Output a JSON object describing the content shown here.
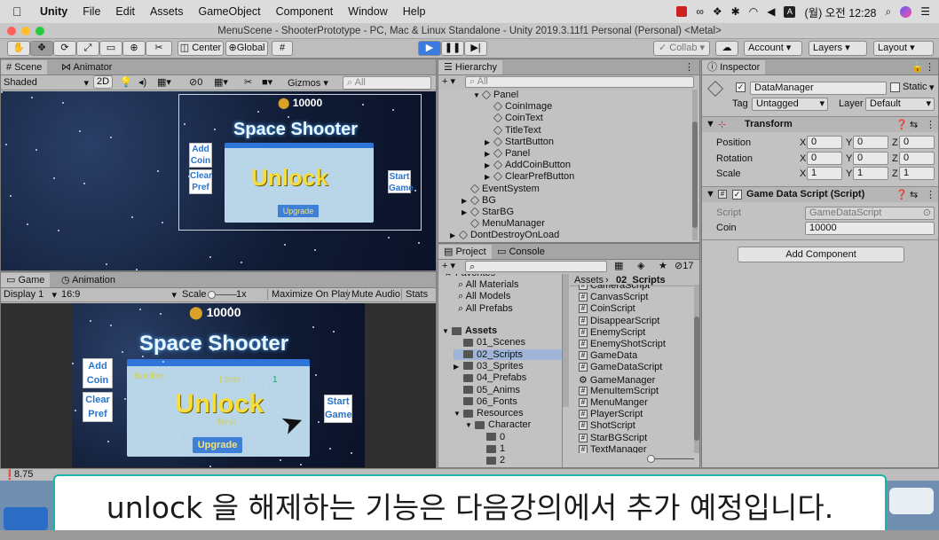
{
  "menubar": {
    "app": "Unity",
    "items": [
      "File",
      "Edit",
      "Assets",
      "GameObject",
      "Component",
      "Window",
      "Help"
    ],
    "clock": "(월) 오전 12:28"
  },
  "window_title": "MenuScene - ShooterPrototype - PC, Mac & Linux Standalone - Unity 2019.3.11f1 Personal (Personal) <Metal>",
  "toolbar": {
    "center": "Center",
    "global": "Global",
    "collab": "Collab",
    "account": "Account",
    "layers": "Layers",
    "layout": "Layout"
  },
  "scene": {
    "tab_scene": "Scene",
    "tab_animator": "Animator",
    "shading": "Shaded",
    "mode2d": "2D",
    "gizmos": "Gizmos",
    "search": "All",
    "hidden_count": "0"
  },
  "game": {
    "tab_game": "Game",
    "tab_animation": "Animation",
    "display": "Display 1",
    "aspect": "16:9",
    "scale_label": "Scale",
    "scale_value": "1x",
    "maximize": "Maximize On Play",
    "mute": "Mute Audio",
    "stats": "Stats",
    "coin": "10000",
    "title": "Space Shooter",
    "add_coin": "Add\nCoin",
    "clear_pref": "Clear\nPref",
    "start_game": "Start\nGame",
    "unlock": "Unlock",
    "bomber": "Bomber",
    "level": "Level :",
    "next": "Next",
    "upgrade": "Upgrade",
    "level_value": "1"
  },
  "hierarchy": {
    "tab": "Hierarchy",
    "search": "All",
    "items": [
      {
        "label": "Panel",
        "indent": 3,
        "arrow": "▼"
      },
      {
        "label": "CoinImage",
        "indent": 4,
        "arrow": ""
      },
      {
        "label": "CoinText",
        "indent": 4,
        "arrow": ""
      },
      {
        "label": "TitleText",
        "indent": 4,
        "arrow": ""
      },
      {
        "label": "StartButton",
        "indent": 4,
        "arrow": "▶"
      },
      {
        "label": "Panel",
        "indent": 4,
        "arrow": "▶"
      },
      {
        "label": "AddCoinButton",
        "indent": 4,
        "arrow": "▶"
      },
      {
        "label": "ClearPrefButton",
        "indent": 4,
        "arrow": "▶"
      },
      {
        "label": "EventSystem",
        "indent": 2,
        "arrow": ""
      },
      {
        "label": "BG",
        "indent": 2,
        "arrow": "▶"
      },
      {
        "label": "StarBG",
        "indent": 2,
        "arrow": "▶"
      },
      {
        "label": "MenuManager",
        "indent": 2,
        "arrow": ""
      },
      {
        "label": "DontDestroyOnLoad",
        "indent": 1,
        "arrow": "▶"
      }
    ]
  },
  "project": {
    "tab_project": "Project",
    "tab_console": "Console",
    "count": "17",
    "breadcrumb_root": "Assets",
    "breadcrumb_leaf": "02_Scripts",
    "favorites": [
      "Favorites",
      "All Materials",
      "All Models",
      "All Prefabs"
    ],
    "tree": [
      {
        "label": "Assets",
        "indent": 0,
        "arrow": "▼",
        "bold": true
      },
      {
        "label": "01_Scenes",
        "indent": 1,
        "arrow": ""
      },
      {
        "label": "02_Scripts",
        "indent": 1,
        "arrow": "",
        "selected": true
      },
      {
        "label": "03_Sprites",
        "indent": 1,
        "arrow": "▶"
      },
      {
        "label": "04_Prefabs",
        "indent": 1,
        "arrow": ""
      },
      {
        "label": "05_Anims",
        "indent": 1,
        "arrow": ""
      },
      {
        "label": "06_Fonts",
        "indent": 1,
        "arrow": ""
      },
      {
        "label": "Resources",
        "indent": 1,
        "arrow": "▼"
      },
      {
        "label": "Character",
        "indent": 2,
        "arrow": "▼"
      },
      {
        "label": "0",
        "indent": 3,
        "arrow": ""
      },
      {
        "label": "1",
        "indent": 3,
        "arrow": ""
      },
      {
        "label": "2",
        "indent": 3,
        "arrow": ""
      }
    ],
    "files": [
      "CameraScript",
      "CanvasScript",
      "CoinScript",
      "DisappearScript",
      "EnemyScript",
      "EnemyShotScript",
      "GameData",
      "GameDataScript",
      "GameManager",
      "MenuItemScript",
      "MenuManger",
      "PlayerScript",
      "ShotScript",
      "StarBGScript",
      "TextManager"
    ]
  },
  "inspector": {
    "tab": "Inspector",
    "name": "DataManager",
    "static": "Static",
    "tag_label": "Tag",
    "tag": "Untagged",
    "layer_label": "Layer",
    "layer": "Default",
    "transform": "Transform",
    "position": "Position",
    "rotation": "Rotation",
    "scale": "Scale",
    "pos": [
      "0",
      "0",
      "0"
    ],
    "rot": [
      "0",
      "0",
      "0"
    ],
    "scl": [
      "1",
      "1",
      "1"
    ],
    "component": "Game Data Script (Script)",
    "script_label": "Script",
    "script": "GameDataScript",
    "coin_label": "Coin",
    "coin": "10000",
    "add_component": "Add Component"
  },
  "status": {
    "value": "8.75"
  },
  "subtitle": "unlock 을 해제하는 기능은 다음강의에서 추가 예정입니다."
}
